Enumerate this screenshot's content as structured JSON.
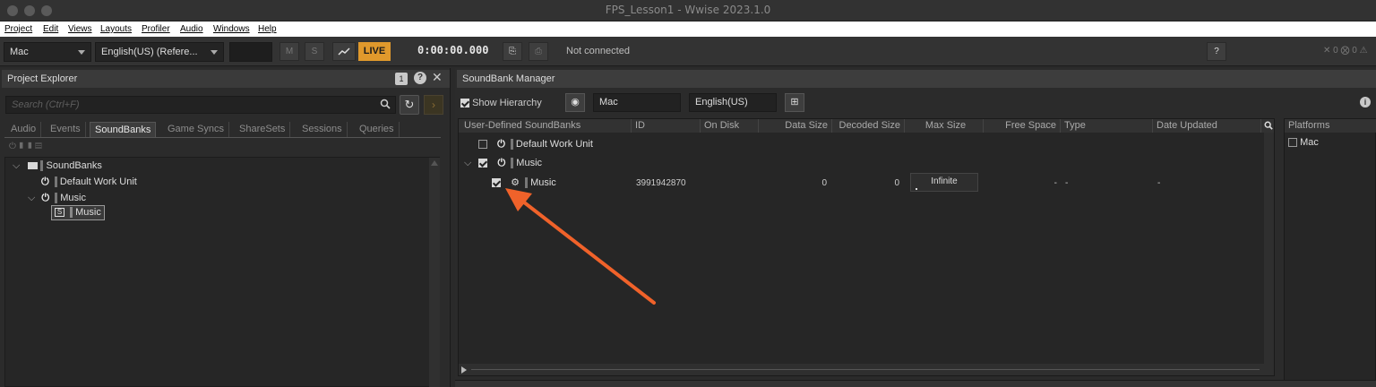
{
  "window": {
    "title": "FPS_Lesson1 - Wwise 2023.1.0"
  },
  "menu": [
    "Project",
    "Edit",
    "Views",
    "Layouts",
    "Profiler",
    "Audio",
    "Windows",
    "Help"
  ],
  "toolbar": {
    "platform": "Mac",
    "language": "English(US) (Refere...",
    "m_label": "M",
    "s_label": "S",
    "live_label": "LIVE",
    "time": "0:00:00.000",
    "connection": "Not connected",
    "help_label": "?",
    "error_counts": "✕ 0 ⨂ 0 ⚠"
  },
  "project_explorer": {
    "title": "Project Explorer",
    "badge": "1",
    "search_placeholder": "Search (Ctrl+F)",
    "tabs": [
      "Audio",
      "Events",
      "SoundBanks",
      "Game Syncs",
      "ShareSets",
      "Sessions",
      "Queries"
    ],
    "active_tab": "SoundBanks",
    "tree": {
      "root": "SoundBanks",
      "default_work_unit": "Default Work Unit",
      "music_work_unit": "Music",
      "music_bank": "Music"
    }
  },
  "soundbank_manager": {
    "title": "SoundBank Manager",
    "show_hierarchy": "Show Hierarchy",
    "platform_field": "Mac",
    "language_field": "English(US)",
    "columns": [
      "User-Defined SoundBanks",
      "ID",
      "On Disk",
      "Data Size",
      "Decoded Size",
      "Max Size",
      "Free Space",
      "Type",
      "Date Updated"
    ],
    "rows": [
      {
        "name": "Default Work Unit",
        "checked": false
      },
      {
        "name": "Music",
        "checked": true
      },
      {
        "name": "Music",
        "checked": true,
        "id": "3991942870",
        "data_size": "0",
        "decoded_size": "0",
        "max_size": "Infinite",
        "free_space": "-",
        "type": "-",
        "date_updated": "-"
      }
    ],
    "platforms_header": "Platforms",
    "platforms": [
      "Mac"
    ]
  },
  "colors": {
    "accent_live": "#e0992c",
    "annotation_arrow": "#f0622a"
  }
}
